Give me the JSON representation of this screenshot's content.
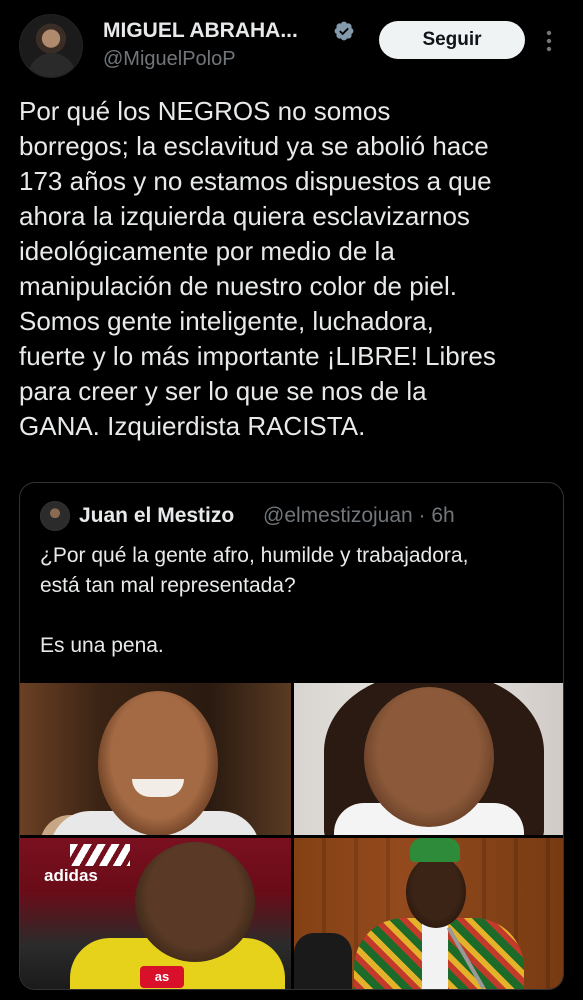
{
  "author": {
    "display_name": "MIGUEL ABRAHA...",
    "handle": "@MiguelPoloP",
    "verified": true,
    "follow_label": "Seguir"
  },
  "tweet": {
    "text": "Por qué los NEGROS no somos\nborregos; la esclavitud ya se abolió hace\n173 años y no estamos dispuestos a que\nahora la izquierda quiera esclavizarnos\nideológicamente por medio de la\nmanipulación de nuestro color de piel.\nSomos gente inteligente, luchadora,\nfuerte y lo más importante ¡LIBRE! Libres\npara creer y ser lo que se nos de la\nGANA. Izquierdista RACISTA."
  },
  "quoted_tweet": {
    "display_name": "Juan el Mestizo",
    "handle_time": "@elmestizojuan · 6h",
    "text": "¿Por qué la gente afro, humilde y trabajadora,\nestá tan mal representada?\n\nEs una pena.",
    "images": [
      {
        "name": "photo-smiling-man"
      },
      {
        "name": "photo-woman"
      },
      {
        "name": "photo-man-yellow-jersey",
        "logo_text": "adidas",
        "badge_text": "as"
      },
      {
        "name": "photo-man-colorful-suit"
      }
    ]
  },
  "colors": {
    "background": "#000000",
    "text_primary": "#e7e9ea",
    "text_secondary": "#71767b",
    "verified_badge": "#829aab",
    "border": "#2f3336",
    "follow_bg": "#eff3f4"
  }
}
